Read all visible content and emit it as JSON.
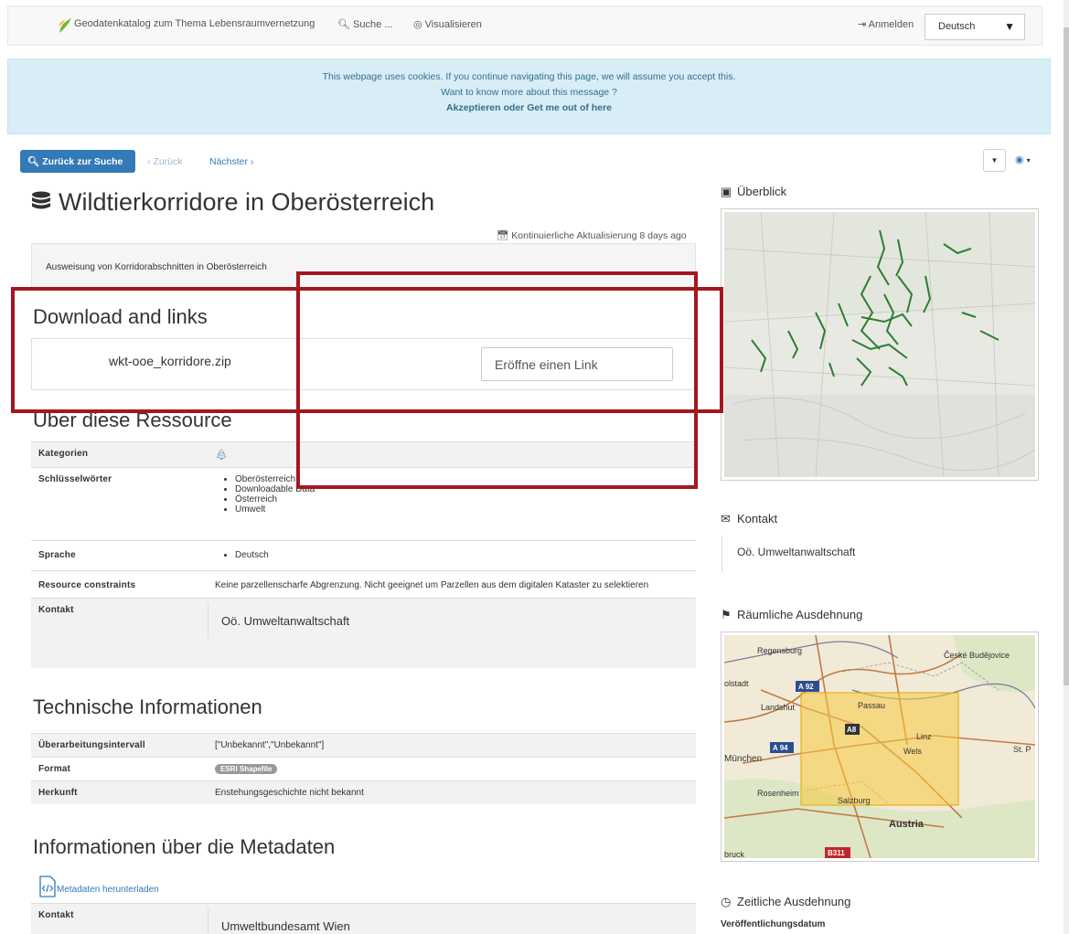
{
  "navbar": {
    "brand": "Geodatenkatalog zum Thema Lebensraumvernetzung",
    "search": "Suche ...",
    "visualize": "Visualisieren",
    "login": "Anmelden",
    "language": "Deutsch"
  },
  "cookie": {
    "line1": "This webpage uses cookies. If you continue navigating this page, we will assume you accept this.",
    "line2": "Want to know more about this message ?",
    "accept": "Akzeptieren",
    "or": "oder",
    "leave": "Get me out of here"
  },
  "actions": {
    "back_to_search": "Zurück zur Suche",
    "previous": "‹ Zurück",
    "next": "Nächster ›"
  },
  "record": {
    "title": "Wildtierkorridore in Oberösterreich",
    "update_note": "Kontinuierliche Aktualisierung 8 days ago",
    "abstract": "Ausweisung von Korridorabschnitten in Oberösterreich"
  },
  "download": {
    "heading": "Download and links",
    "file": "wkt-ooe_korridore.zip",
    "link_placeholder": "Eröffne einen Link"
  },
  "about": {
    "heading": "Über diese Ressource",
    "categories_label": "Kategorien",
    "keywords_label": "Schlüsselwörter",
    "keywords": [
      "Oberösterreich",
      "Downloadable Data",
      "Österreich",
      "Umwelt"
    ],
    "language_label": "Sprache",
    "languages": [
      "Deutsch"
    ],
    "constraints_label": "Resource constraints",
    "constraints": "Keine parzellenscharfe Abgrenzung. Nicht geeignet um Parzellen aus dem digitalen Kataster zu selektieren",
    "contact_label": "Kontakt",
    "contact": "Oö. Umweltanwaltschaft"
  },
  "technical": {
    "heading": "Technische Informationen",
    "interval_label": "Überarbeitungsintervall",
    "interval": "[\"Unbekannt\",\"Unbekannt\"]",
    "format_label": "Format",
    "format": "ESRI Shapefile",
    "origin_label": "Herkunft",
    "origin": "Enstehungsgeschichte nicht bekannt"
  },
  "metadata": {
    "heading": "Informationen über die Metadaten",
    "download_link": "Metadaten herunterladen",
    "contact_label": "Kontakt",
    "contact": "Umweltbundesamt Wien"
  },
  "sidebar": {
    "overview": "Überblick",
    "contact": "Kontakt",
    "contact_name": "Oö. Umweltanwaltschaft",
    "extent": "Räumliche Ausdehnung",
    "temporal": "Zeitliche Ausdehnung",
    "pub_date_label": "Veröffentlichungsdatum",
    "map_labels": {
      "regensburg": "Regensburg",
      "budejovice": "České Budějovice",
      "ingolstadt": "olstadt",
      "landshut": "Landshut",
      "passau": "Passau",
      "linz": "Linz",
      "wels": "Wels",
      "munchen": "München",
      "stpolten": "St. P",
      "rosenheim": "Rosenheim",
      "salzburg": "Salzburg",
      "austria": "Austria",
      "bruck": "bruck",
      "a92": "A 92",
      "a8": "A8",
      "a94": "A 94",
      "b311": "B311"
    }
  },
  "colors": {
    "primary": "#337ab7",
    "highlight_red": "#a3171f",
    "cookie_bg": "#d9edf7",
    "extent_fill": "#f8c840"
  }
}
